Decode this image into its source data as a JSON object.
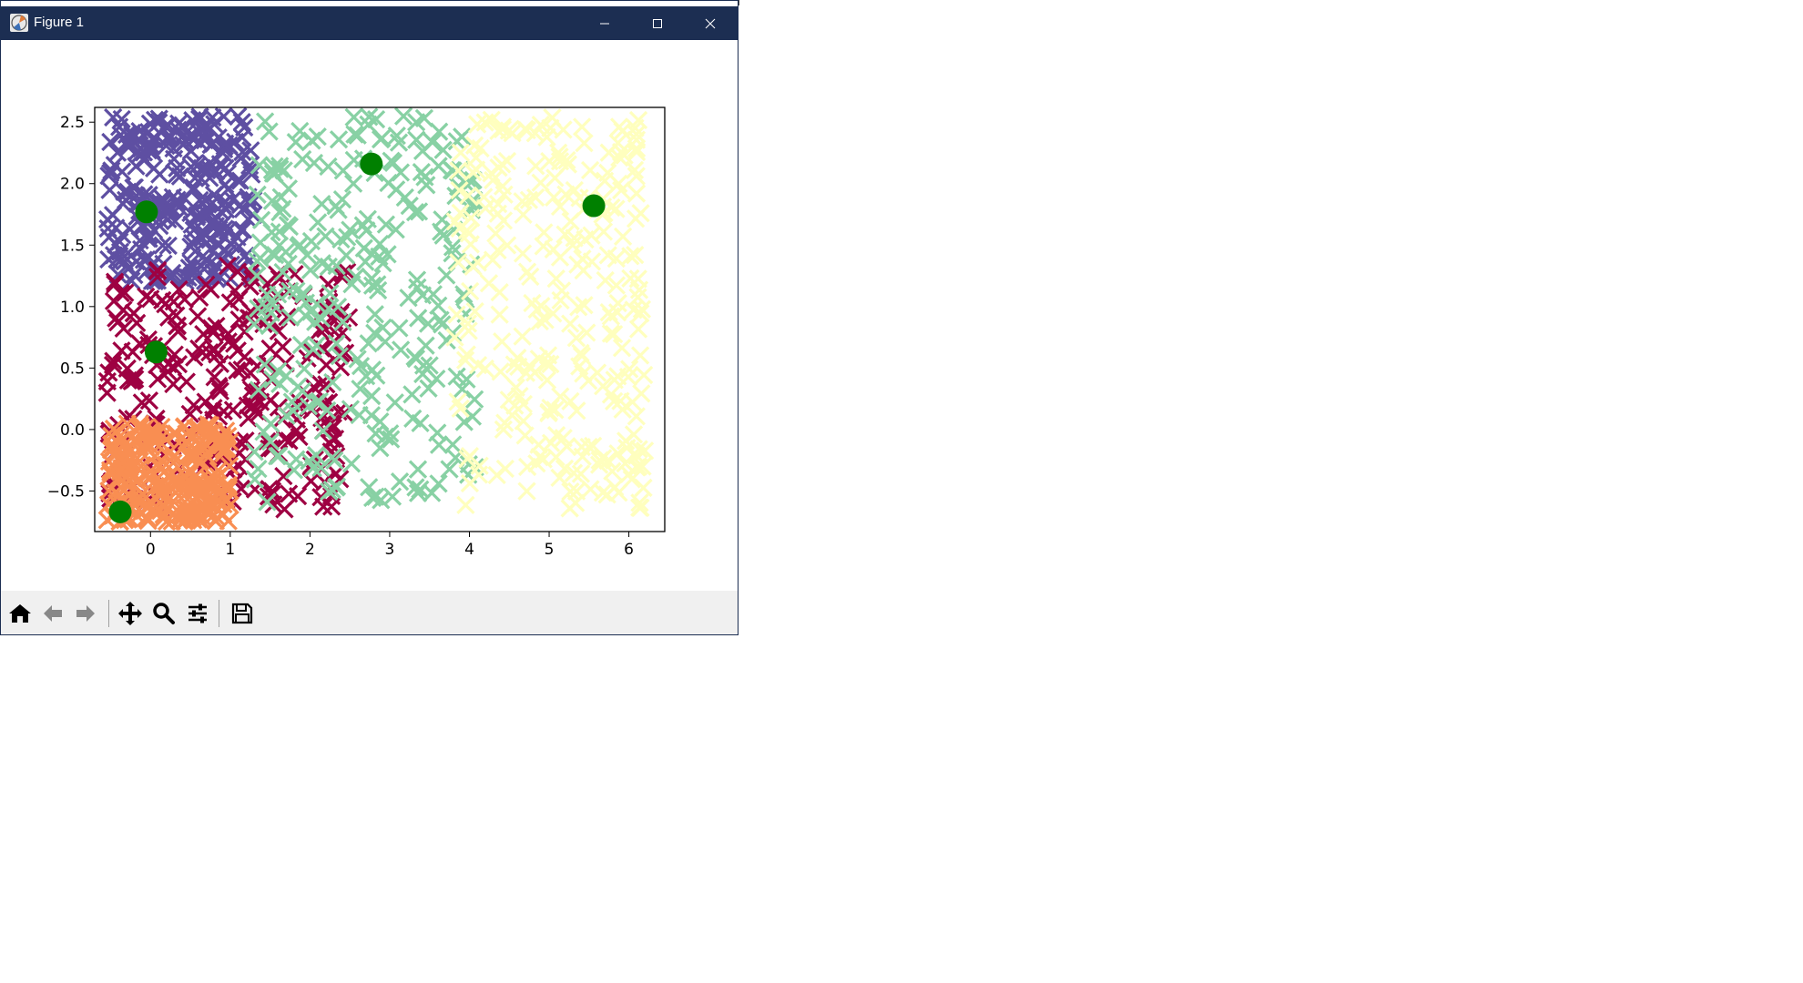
{
  "window": {
    "title": "Figure 1",
    "controls": [
      "minimize",
      "maximize",
      "close"
    ]
  },
  "toolbar": {
    "buttons": [
      "home-icon",
      "back-arrow-icon",
      "forward-arrow-icon",
      "pan-icon",
      "zoom-icon",
      "configure-subplots-icon",
      "save-icon"
    ]
  },
  "chart_data": {
    "type": "scatter",
    "title": "",
    "xlabel": "",
    "ylabel": "",
    "xlim": [
      -0.7,
      6.45
    ],
    "ylim": [
      -0.83,
      2.62
    ],
    "xticks": [
      "0",
      "1",
      "2",
      "3",
      "4",
      "5",
      "6"
    ],
    "yticks": [
      "−0.5",
      "0.0",
      "0.5",
      "1.0",
      "1.5",
      "2.0",
      "2.5"
    ],
    "grid": false,
    "legend": "none",
    "marker_series": "x",
    "cluster_colors": [
      "#5e4fa2",
      "#9e0142",
      "#f98e52",
      "#88d1a4",
      "#ffffbe"
    ],
    "clusters": [
      {
        "color": "#5e4fa2",
        "x_range": [
          -0.55,
          1.3
        ],
        "y_range": [
          1.2,
          2.55
        ]
      },
      {
        "color": "#9e0142",
        "x_range": [
          -0.55,
          2.5
        ],
        "y_range": [
          -0.65,
          1.35
        ]
      },
      {
        "color": "#f98e52",
        "x_range": [
          -0.55,
          1.0
        ],
        "y_range": [
          -0.75,
          0.05
        ]
      },
      {
        "color": "#88d1a4",
        "x_range": [
          1.3,
          4.1
        ],
        "y_range": [
          -0.6,
          2.55
        ]
      },
      {
        "color": "#ffffbe",
        "x_range": [
          3.8,
          6.2
        ],
        "y_range": [
          -0.65,
          2.55
        ]
      }
    ],
    "centroids": {
      "color": "#008000",
      "points": [
        {
          "x": -0.05,
          "y": 1.77
        },
        {
          "x": 0.07,
          "y": 0.63
        },
        {
          "x": -0.38,
          "y": -0.67
        },
        {
          "x": 2.77,
          "y": 2.16
        },
        {
          "x": 5.56,
          "y": 1.82
        }
      ]
    }
  }
}
